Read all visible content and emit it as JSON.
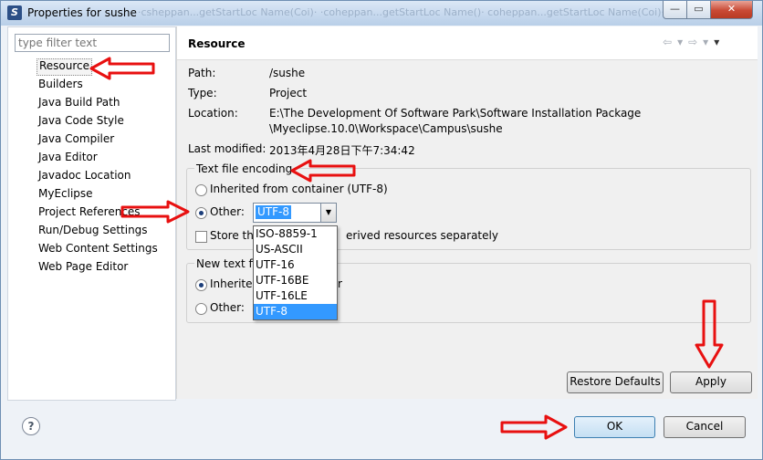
{
  "window": {
    "title": "Properties for sushe",
    "ghost_title": "·csheppan...getStartLoc Name(Coi)· ·coheppan...getStartLoc Name()· coheppan...getStartLoc Name(Coi)·"
  },
  "left": {
    "filter_placeholder": "type filter text",
    "items": [
      "Resource",
      "Builders",
      "Java Build Path",
      "Java Code Style",
      "Java Compiler",
      "Java Editor",
      "Javadoc Location",
      "MyEclipse",
      "Project References",
      "Run/Debug Settings",
      "Web Content Settings",
      "Web Page Editor"
    ]
  },
  "resource": {
    "title": "Resource",
    "path_label": "Path:",
    "path_value": "/sushe",
    "type_label": "Type:",
    "type_value": "Project",
    "location_label": "Location:",
    "location_line1": "E:\\The Development Of Software Park\\Software Installation Package",
    "location_line2": "\\Myeclipse.10.0\\Workspace\\Campus\\sushe",
    "modified_label": "Last modified:",
    "modified_value": "2013年4月28日下午7:34:42"
  },
  "encoding": {
    "group_title": "Text file encoding",
    "inherited_label": "Inherited from container (UTF-8)",
    "other_label": "Other:",
    "selected": "UTF-8",
    "options": [
      "ISO-8859-1",
      "US-ASCII",
      "UTF-16",
      "UTF-16BE",
      "UTF-16LE",
      "UTF-8"
    ],
    "store_label_left": "Store th",
    "store_label_right": "erived resources separately"
  },
  "delimiter": {
    "group_title": "New text fi",
    "inherited_label": "Inherited",
    "inherited_tail": "r",
    "other_label": "Other:"
  },
  "buttons": {
    "restore_defaults": "Restore Defaults",
    "apply": "Apply",
    "ok": "OK",
    "cancel": "Cancel"
  },
  "colors": {
    "arrow": "#e81010",
    "selection": "#3399ff"
  }
}
